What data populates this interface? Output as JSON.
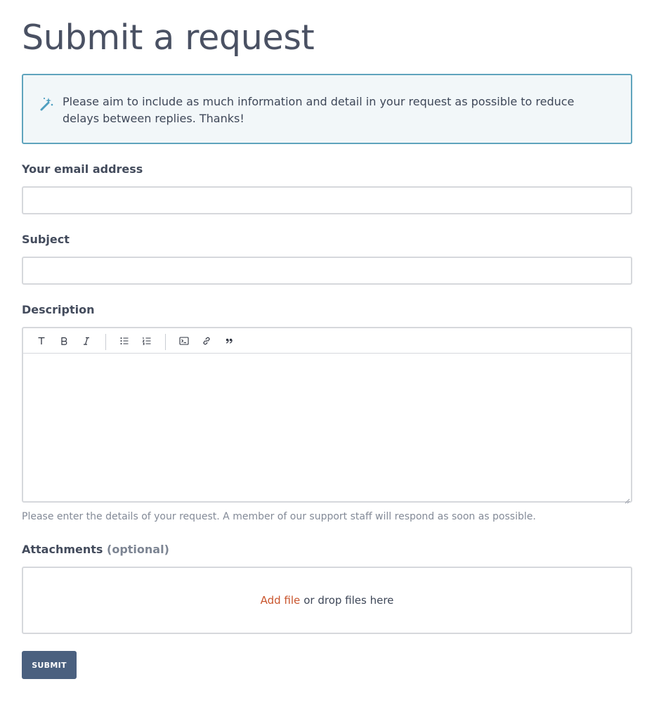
{
  "page": {
    "title": "Submit a request"
  },
  "notice": {
    "icon": "magic-wand-icon",
    "text": "Please aim to include as much information and detail in your request as possible to reduce delays between replies. Thanks!"
  },
  "fields": {
    "email": {
      "label": "Your email address",
      "value": "",
      "placeholder": ""
    },
    "subject": {
      "label": "Subject",
      "value": "",
      "placeholder": ""
    },
    "description": {
      "label": "Description",
      "hint": "Please enter the details of your request. A member of our support staff will respond as soon as possible.",
      "toolbar": [
        {
          "name": "text-format-icon",
          "glyph": "T"
        },
        {
          "name": "bold-icon",
          "glyph": "B"
        },
        {
          "name": "italic-icon",
          "glyph": "I"
        },
        {
          "name": "bulleted-list-icon",
          "glyph": ""
        },
        {
          "name": "numbered-list-icon",
          "glyph": ""
        },
        {
          "name": "code-block-icon",
          "glyph": ""
        },
        {
          "name": "link-icon",
          "glyph": ""
        },
        {
          "name": "quote-icon",
          "glyph": ""
        }
      ]
    },
    "attachments": {
      "label": "Attachments",
      "optional": "(optional)",
      "add_file": "Add file",
      "drop_text": "or drop files here"
    }
  },
  "actions": {
    "submit_label": "SUBMIT"
  },
  "colors": {
    "accent_link": "#c9552d",
    "notice_border": "#5fa4bd",
    "notice_bg": "#f2f7f9",
    "button_bg": "#4a607f"
  }
}
